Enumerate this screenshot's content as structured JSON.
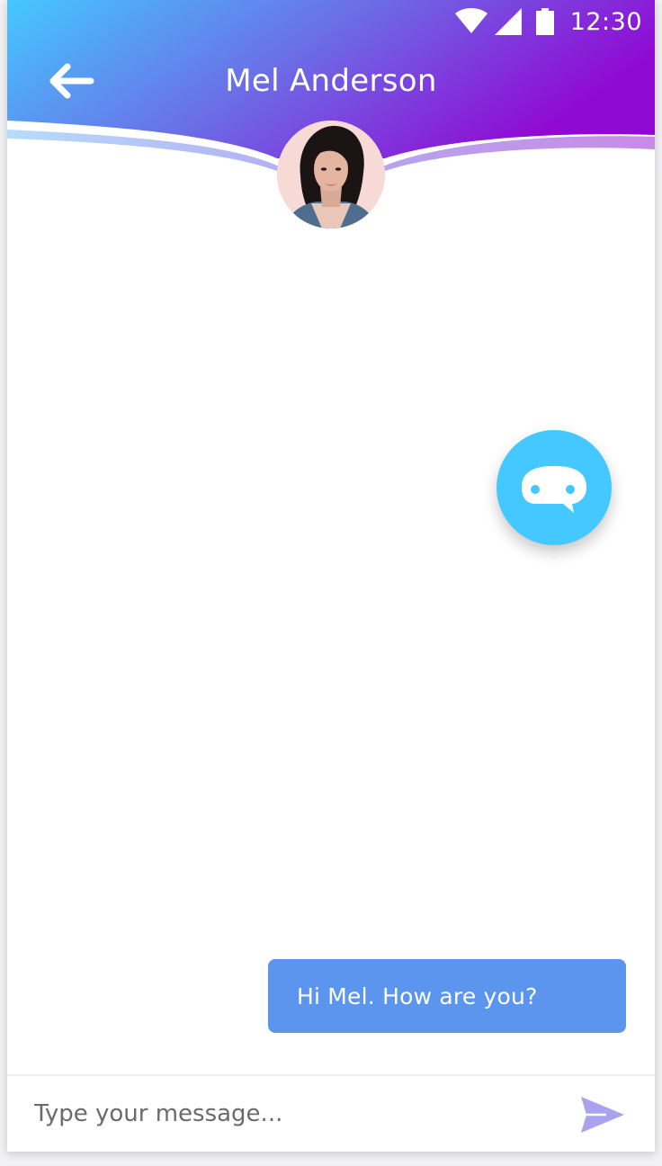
{
  "status_bar": {
    "time": "12:30",
    "icons": [
      "wifi-icon",
      "cell-signal-icon",
      "battery-icon"
    ]
  },
  "header": {
    "title": "Mel Anderson",
    "back_icon": "arrow-left-icon",
    "gradient_start": "#45c8ff",
    "gradient_end": "#9009d3"
  },
  "avatar": {
    "icon": "profile-photo"
  },
  "fab": {
    "icon": "chat-bot-icon",
    "color": "#45c8ff"
  },
  "messages": [
    {
      "from": "me",
      "text": "Hi Mel. How are you?",
      "color": "#5b95ee"
    }
  ],
  "composer": {
    "placeholder": "Type your message...",
    "value": "",
    "send_icon": "send-icon",
    "send_color": "#a9a3ef"
  }
}
